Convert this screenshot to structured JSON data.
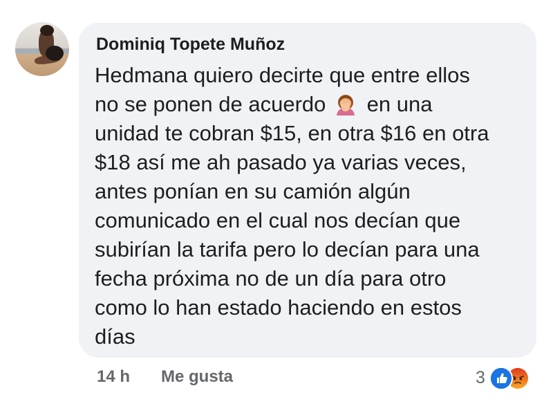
{
  "comment": {
    "author": "Dominiq Topete Muñoz",
    "message_lines": [
      {
        "text": "Hedmana quiero decirte que entre ellos"
      },
      {
        "before": "no se ponen de acuerdo",
        "emoji": "woman-facepalming-icon",
        "after": "en una"
      },
      {
        "text": "unidad te cobran $15, en otra $16 en otra"
      },
      {
        "text": "$18 así me ah pasado ya varias veces,"
      },
      {
        "text": "antes ponían en su camión algún"
      },
      {
        "text": "comunicado en el cual nos decían que"
      },
      {
        "text": "subirían la tarifa pero lo decían para una"
      },
      {
        "text": "fecha próxima no de un día para otro"
      },
      {
        "text": "como lo han estado haciendo en estos"
      },
      {
        "text": "días"
      }
    ]
  },
  "footer": {
    "timestamp": "14 h",
    "like_label": "Me gusta"
  },
  "reactions": {
    "count": "3",
    "icons": [
      "like-reaction-icon",
      "angry-reaction-icon"
    ]
  },
  "colors": {
    "bubble": "#f0f2f5",
    "text": "#1c1e21",
    "secondary": "#65676b",
    "like_blue": "#1b74e4",
    "angry_orange": "#f0521e"
  }
}
